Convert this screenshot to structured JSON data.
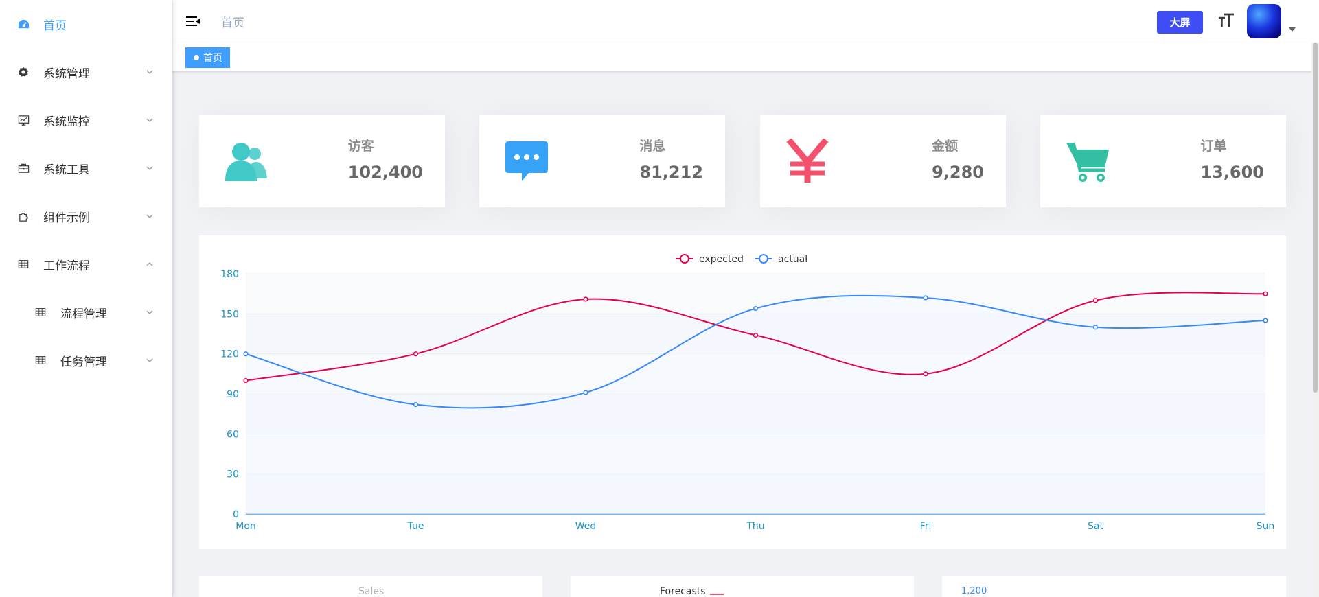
{
  "sidebar": {
    "items": [
      {
        "label": "首页",
        "icon": "dashboard-icon",
        "active": true,
        "chevron": ""
      },
      {
        "label": "系统管理",
        "icon": "gear-icon",
        "chevron": "down"
      },
      {
        "label": "系统监控",
        "icon": "monitor-icon",
        "chevron": "down"
      },
      {
        "label": "系统工具",
        "icon": "toolbox-icon",
        "chevron": "down"
      },
      {
        "label": "组件示例",
        "icon": "puzzle-icon",
        "chevron": "down"
      },
      {
        "label": "工作流程",
        "icon": "table-icon",
        "chevron": "up"
      },
      {
        "label": "流程管理",
        "icon": "table-icon",
        "chevron": "down",
        "sub": true
      },
      {
        "label": "任务管理",
        "icon": "table-icon",
        "chevron": "down",
        "sub": true
      }
    ]
  },
  "header": {
    "breadcrumb": "首页",
    "bigscreen_label": "大屏"
  },
  "tags": {
    "active": "首页"
  },
  "cards": [
    {
      "label": "访客",
      "value": "102,400",
      "icon": "users-icon",
      "color": "#40c9c6"
    },
    {
      "label": "消息",
      "value": "81,212",
      "icon": "message-icon",
      "color": "#36a3f7"
    },
    {
      "label": "金额",
      "value": "9,280",
      "icon": "yen-icon",
      "color": "#f4516c"
    },
    {
      "label": "订单",
      "value": "13,600",
      "icon": "cart-icon",
      "color": "#34bfa3"
    }
  ],
  "chart_data": {
    "type": "line",
    "categories": [
      "Mon",
      "Tue",
      "Wed",
      "Thu",
      "Fri",
      "Sat",
      "Sun"
    ],
    "series": [
      {
        "name": "expected",
        "values": [
          100,
          120,
          161,
          134,
          105,
          160,
          165
        ],
        "color": "#e6004c"
      },
      {
        "name": "actual",
        "values": [
          120,
          82,
          91,
          154,
          162,
          140,
          145
        ],
        "color": "#3888fa"
      }
    ],
    "yticks": [
      0,
      30,
      60,
      90,
      120,
      150,
      180
    ],
    "ylim": [
      0,
      180
    ],
    "legend": "top-center",
    "grid": true
  },
  "bottom": {
    "sales_title": "Sales",
    "forecasts_title": "Forecasts",
    "third_axis_label": "1,200"
  }
}
